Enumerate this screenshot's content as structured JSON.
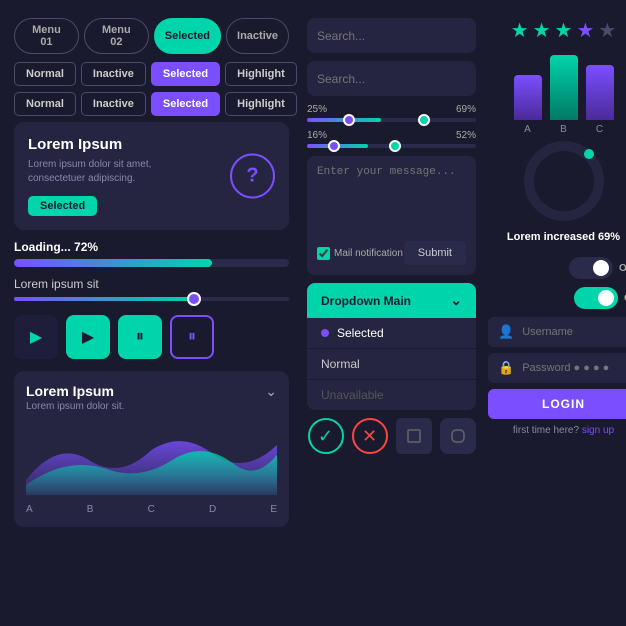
{
  "tabs": {
    "menu01": "Menu 01",
    "menu02": "Menu 02",
    "selected": "Selected",
    "inactive": "Inactive"
  },
  "button_rows": [
    [
      "Normal",
      "Inactive",
      "Selected",
      "Highlight"
    ],
    [
      "Normal",
      "Inactive",
      "Selected",
      "Highlight"
    ]
  ],
  "lorem_card": {
    "title": "Lorem Ipsum",
    "body": "Lorem ipsum dolor sit amet, consectetuer adipiscing.",
    "button": "Selected"
  },
  "loading": {
    "label": "Loading...",
    "value": "72%",
    "percent": 72
  },
  "slider": {
    "label": "Lorem ipsum sit",
    "value": 65
  },
  "search_bars": [
    {
      "placeholder": "Search...",
      "button_color": "teal"
    },
    {
      "placeholder": "Search...",
      "button_color": "purple"
    }
  ],
  "range_sliders": [
    {
      "left_pct": "25%",
      "right_pct": "69%",
      "fill_start": 25,
      "fill_end": 69
    },
    {
      "left_pct": "16%",
      "right_pct": "52%",
      "fill_start": 16,
      "fill_end": 52
    }
  ],
  "message": {
    "placeholder": "Enter your message...",
    "mail_label": "Mail notification",
    "submit": "Submit"
  },
  "dropdown": {
    "header": "Dropdown Main",
    "items": [
      {
        "label": "Selected",
        "state": "selected",
        "dot": true
      },
      {
        "label": "Normal",
        "state": "normal",
        "dot": false
      },
      {
        "label": "Unavailable",
        "state": "unavailable",
        "dot": false
      }
    ]
  },
  "stars": {
    "filled": 3,
    "half": 1,
    "empty": 1
  },
  "bar_chart": {
    "bars": [
      {
        "label": "A",
        "style": "bar-a"
      },
      {
        "label": "B",
        "style": "bar-b"
      },
      {
        "label": "C",
        "style": "bar-c"
      }
    ]
  },
  "dial": {
    "label": "Lorem increased",
    "value": "69%"
  },
  "toggles": [
    {
      "state": "off",
      "label": "OFF"
    },
    {
      "state": "on",
      "label": "ON"
    }
  ],
  "login": {
    "username_placeholder": "Username",
    "password_placeholder": "Password ● ● ● ●",
    "button": "LOGIN",
    "first_time": "first time here?",
    "sign_up": "sign up"
  },
  "media_buttons": [
    "▶",
    "▶",
    "⏸",
    "⏸"
  ],
  "chart": {
    "title": "Lorem Ipsum",
    "subtitle": "Lorem ipsum dolor sit.",
    "labels": [
      "A",
      "B",
      "C",
      "D",
      "E"
    ]
  },
  "icon_buttons": [
    "✓",
    "✕",
    "",
    ""
  ]
}
